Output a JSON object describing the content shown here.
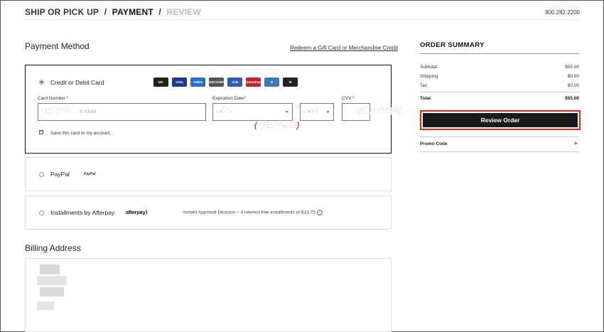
{
  "breadcrumb": {
    "ship": "SHIP OR PICK UP",
    "sep": "/",
    "payment": "PAYMENT",
    "review": "REVIEW"
  },
  "phone": "800.282.2200",
  "payment_method": {
    "title": "Payment Method",
    "gift_link": "Redeem a Gift Card or Merchandise Credit",
    "credit": {
      "label": "Credit or Debit Card",
      "card_number_label": "Card Number *",
      "card_number_placeholder": "X XXXX",
      "expiration_label": "Expiration Date*",
      "month_placeholder": "-- MM --",
      "year_placeholder": "-- YY",
      "cvv_label": "CVV *",
      "save_label": "Save this card to my account.",
      "logos": [
        {
          "name": "mastercard-icon",
          "text": "MC",
          "color": "#222222"
        },
        {
          "name": "visa-icon",
          "text": "VISA",
          "color": "#1a3a8e"
        },
        {
          "name": "amex-icon",
          "text": "AMEX",
          "color": "#2a6fc7"
        },
        {
          "name": "discover-icon",
          "text": "DISCOVER",
          "color": "#555555"
        },
        {
          "name": "jcb-icon",
          "text": "JCB",
          "color": "#2f5fb3"
        },
        {
          "name": "unionpay-icon",
          "text": "UnionPay",
          "color": "#c0242b"
        },
        {
          "name": "diners-icon",
          "text": "D",
          "color": "#3d7ab8"
        },
        {
          "name": "maestro-icon",
          "text": "M",
          "color": "#222222"
        }
      ]
    },
    "paypal": {
      "label": "PayPal",
      "logo": "PayPal"
    },
    "afterpay": {
      "label": "Installments by Afterpay",
      "logo": "afterpay⟩",
      "note": "Instant Approval Decision – 4 interest-free installments of $13.75"
    }
  },
  "billing": {
    "title": "Billing Address"
  },
  "annotations": {
    "card_number": "카드번호",
    "month": "월",
    "year": "년",
    "expiry": "(카드만료일)",
    "cvv": "카드보안넘버"
  },
  "order_summary": {
    "title": "ORDER SUMMARY",
    "rows": [
      {
        "label": "Subtotal",
        "value": "$55.00"
      },
      {
        "label": "Shipping",
        "value": "$0.00"
      },
      {
        "label": "Tax",
        "value": "$0.00"
      }
    ],
    "total_label": "Total",
    "total_value": "$55.00",
    "review_button": "Review Order",
    "promo": "Promo Code",
    "promo_toggle": "+"
  },
  "colors": {
    "accent": "#e1251b",
    "button": "#1a1a1a"
  }
}
